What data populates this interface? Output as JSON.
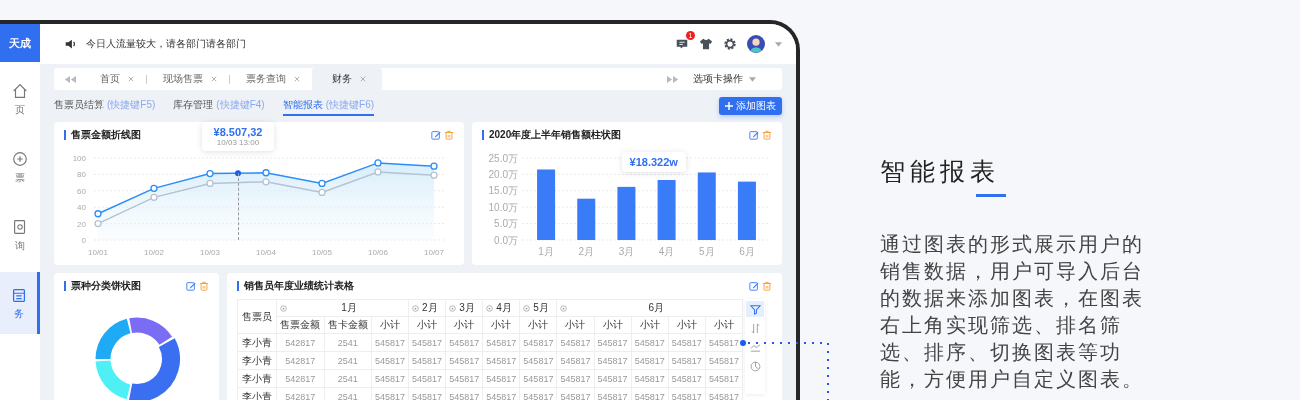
{
  "sidebar": {
    "logo": "天成",
    "items": [
      {
        "label": "页",
        "kind": "home",
        "selected": false
      },
      {
        "label": "票",
        "kind": "ticket",
        "selected": false
      },
      {
        "label": "询",
        "kind": "search",
        "selected": false
      },
      {
        "label": "务",
        "kind": "finance",
        "selected": true
      }
    ]
  },
  "topbar": {
    "notice": "今日人流量较大，请各部门请各部门",
    "badge": "1"
  },
  "tabs": [
    {
      "label": "首页",
      "selected": false
    },
    {
      "label": "现场售票",
      "selected": false
    },
    {
      "label": "票务查询",
      "selected": false
    },
    {
      "label": "财务",
      "selected": true
    }
  ],
  "tab_menu": "选项卡操作",
  "subnav": [
    {
      "label": "售票员结算",
      "shortcut": "(快捷键F5)",
      "selected": false
    },
    {
      "label": "库存管理",
      "shortcut": "(快捷键F4)",
      "selected": false
    },
    {
      "label": "智能报表",
      "shortcut": "(快捷键F6)",
      "selected": true
    }
  ],
  "add_button": "添加图表",
  "line_card": {
    "title": "售票金额折线图",
    "tooltip": {
      "value": "¥8.507,32",
      "time": "10/03 13:00"
    },
    "chart_data": {
      "type": "line",
      "grid": true,
      "categories": [
        "10/01",
        "10/02",
        "10/03",
        "10/04",
        "10/05",
        "10/06",
        "10/07"
      ],
      "ylim": [
        0,
        100
      ],
      "yticks": [
        0,
        20,
        40,
        60,
        80,
        100
      ],
      "series": [
        {
          "color": "#2b8ef8",
          "type": "area",
          "marker": true,
          "values": [
            32,
            63,
            81,
            82,
            69,
            94,
            90
          ]
        },
        {
          "color": "#b4c3d3",
          "type": "line",
          "marker": true,
          "values": [
            20,
            52,
            69,
            71,
            58,
            83,
            79
          ]
        }
      ]
    }
  },
  "bar_card": {
    "title": "2020年度上半年销售额柱状图",
    "tooltip": "¥18.322w",
    "chart_data": {
      "type": "bar",
      "grid": true,
      "categories": [
        "1月",
        "2月",
        "3月",
        "4月",
        "5月",
        "6月"
      ],
      "ylim": [
        0,
        25
      ],
      "yticks": [
        {
          "value": 0,
          "label": "0.0万"
        },
        {
          "value": 5,
          "label": "5.0万"
        },
        {
          "value": 10,
          "label": "10.0万"
        },
        {
          "value": 15,
          "label": "15.0万"
        },
        {
          "value": 20,
          "label": "20.0万"
        },
        {
          "value": 25,
          "label": "25.0万"
        }
      ],
      "series": [
        {
          "color": "#3a7bf7",
          "values": [
            21.5,
            12.6,
            16.2,
            18.3,
            20.6,
            17.8
          ]
        }
      ]
    }
  },
  "pie_card": {
    "title": "票种分类饼状图"
  },
  "table_card": {
    "title": "销售员年度业绩统计表格",
    "name_header": "售票员",
    "months": [
      {
        "label": "1月",
        "columns": [
          "售票金额",
          "售卡金额",
          "小计"
        ]
      },
      {
        "label": "2月",
        "columns": [
          "小计"
        ]
      },
      {
        "label": "3月",
        "columns": [
          "小计"
        ]
      },
      {
        "label": "4月",
        "columns": [
          "小计"
        ]
      },
      {
        "label": "5月",
        "columns": [
          "小计"
        ]
      },
      {
        "label": "6月",
        "columns": [
          "小计",
          "小计",
          "小计",
          "小计",
          "小计"
        ]
      }
    ],
    "rows": [
      {
        "name": "李小青",
        "cells": [
          "542817",
          "2541",
          "545817",
          "545817",
          "545817",
          "545817",
          "545817",
          "545817",
          "545817",
          "545817",
          "545817",
          "545817"
        ]
      },
      {
        "name": "李小青",
        "cells": [
          "542817",
          "2541",
          "545817",
          "545817",
          "545817",
          "545817",
          "545817",
          "545817",
          "545817",
          "545817",
          "545817",
          "545817"
        ]
      },
      {
        "name": "李小青",
        "cells": [
          "542817",
          "2541",
          "545817",
          "545817",
          "545817",
          "545817",
          "545817",
          "545817",
          "545817",
          "545817",
          "545817",
          "545817"
        ]
      },
      {
        "name": "李小青",
        "cells": [
          "542817",
          "2541",
          "545817",
          "545817",
          "545817",
          "545817",
          "545817",
          "545817",
          "545817",
          "545817",
          "545817",
          "545817"
        ]
      }
    ],
    "tools": [
      {
        "kind": "filter",
        "selected": true
      },
      {
        "kind": "sort",
        "selected": false
      },
      {
        "kind": "line",
        "selected": false
      },
      {
        "kind": "pie",
        "selected": false
      }
    ]
  },
  "feature": {
    "title": "智能报表",
    "description": "通过图表的形式展示用户的销售数据，用户可导入后台的数据来添加图表，在图表右上角实现筛选、排名筛选、排序、切换图表等功能，方便用户自定义图表。"
  }
}
